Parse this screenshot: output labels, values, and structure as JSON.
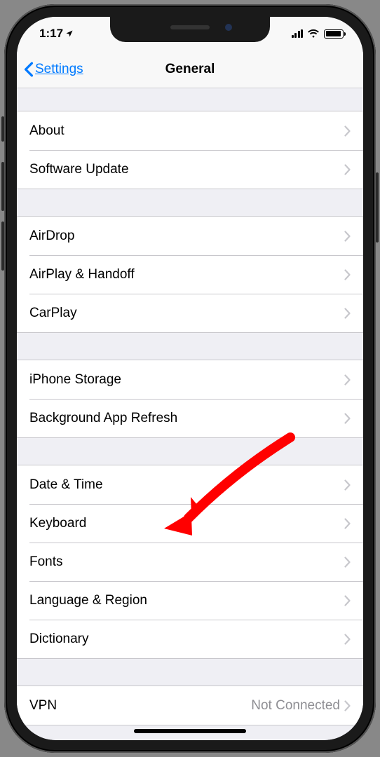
{
  "status": {
    "time": "1:17",
    "location_arrow": "➤"
  },
  "nav": {
    "back_label": "Settings",
    "title": "General"
  },
  "groups": [
    {
      "items": [
        {
          "key": "about",
          "label": "About"
        },
        {
          "key": "software-update",
          "label": "Software Update"
        }
      ]
    },
    {
      "items": [
        {
          "key": "airdrop",
          "label": "AirDrop"
        },
        {
          "key": "airplay-handoff",
          "label": "AirPlay & Handoff"
        },
        {
          "key": "carplay",
          "label": "CarPlay"
        }
      ]
    },
    {
      "items": [
        {
          "key": "iphone-storage",
          "label": "iPhone Storage"
        },
        {
          "key": "background-app-refresh",
          "label": "Background App Refresh"
        }
      ]
    },
    {
      "items": [
        {
          "key": "date-time",
          "label": "Date & Time"
        },
        {
          "key": "keyboard",
          "label": "Keyboard"
        },
        {
          "key": "fonts",
          "label": "Fonts"
        },
        {
          "key": "language-region",
          "label": "Language & Region"
        },
        {
          "key": "dictionary",
          "label": "Dictionary"
        }
      ]
    },
    {
      "items": [
        {
          "key": "vpn",
          "label": "VPN",
          "value": "Not Connected"
        }
      ]
    }
  ],
  "annotation": {
    "arrow_color": "#ff0000",
    "target_row_key": "date-time"
  }
}
